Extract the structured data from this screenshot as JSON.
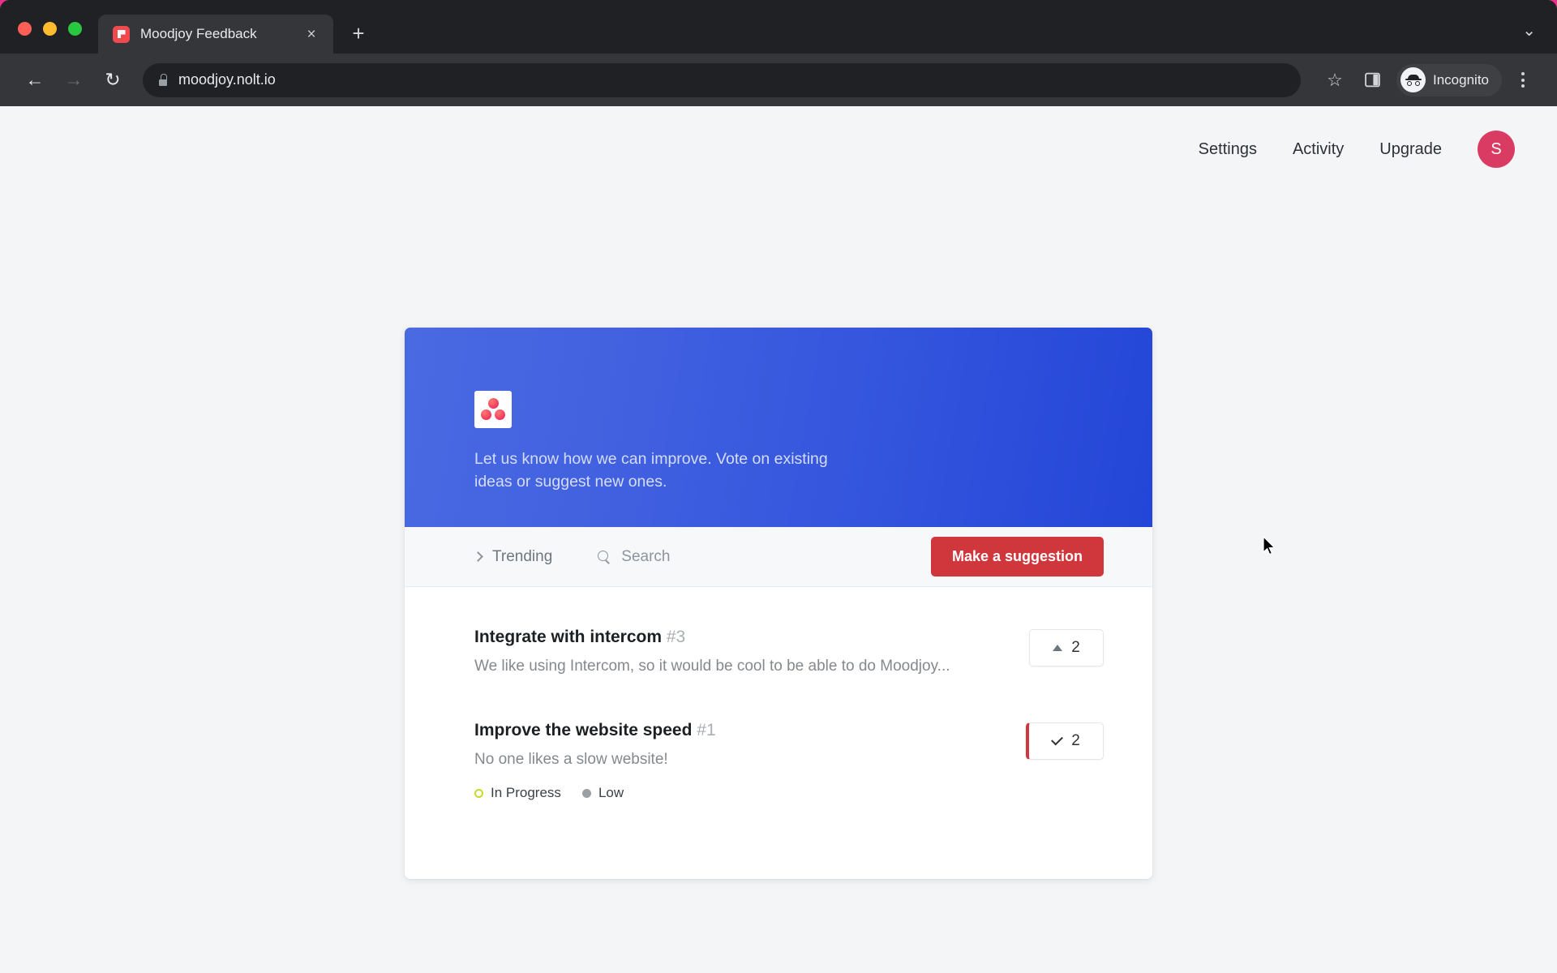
{
  "browser": {
    "tab": {
      "title": "Moodjoy Feedback",
      "favicon": "moodjoy-favicon",
      "close_label": "×"
    },
    "new_tab_label": "+",
    "tab_list_chevron": "⌄",
    "nav": {
      "back": "←",
      "forward": "→",
      "reload": "↻"
    },
    "address": {
      "url": "moodjoy.nolt.io",
      "secure_icon": "lock-icon"
    },
    "actions": {
      "bookmark": "☆",
      "side_panel": "side-panel-icon",
      "profile_label": "Incognito",
      "menu": "kebab-menu-icon"
    }
  },
  "page": {
    "nav_links": [
      {
        "label": "Settings"
      },
      {
        "label": "Activity"
      },
      {
        "label": "Upgrade"
      }
    ],
    "avatar": {
      "initial": "S",
      "color": "#da3b63"
    },
    "hero": {
      "logo": "moodjoy-logo",
      "tagline": "Let us know how we can improve. Vote on existing ideas or suggest new ones.",
      "gradient_from": "#4a6ae2",
      "gradient_to": "#2446d8"
    },
    "toolbar": {
      "sort_label": "Trending",
      "sort_icon": "chevron-right-icon",
      "search_placeholder": "Search",
      "search_icon": "search-icon",
      "suggest_label": "Make a suggestion",
      "suggest_color": "#d0373c"
    },
    "items": [
      {
        "title": "Integrate with intercom",
        "number": "#3",
        "description": "We like using Intercom, so it would be cool to be able to do Moodjoy...",
        "votes": "2",
        "voted": false,
        "vote_icon": "upvote-triangle-icon",
        "badges": []
      },
      {
        "title": "Improve the website speed",
        "number": "#1",
        "description": "No one likes a slow website!",
        "votes": "2",
        "voted": true,
        "vote_icon": "check-icon",
        "badges": [
          {
            "label": "In Progress",
            "style": "ring",
            "color": "#c7da27"
          },
          {
            "label": "Low",
            "style": "solid",
            "color": "#9aa0a6"
          }
        ]
      }
    ]
  }
}
